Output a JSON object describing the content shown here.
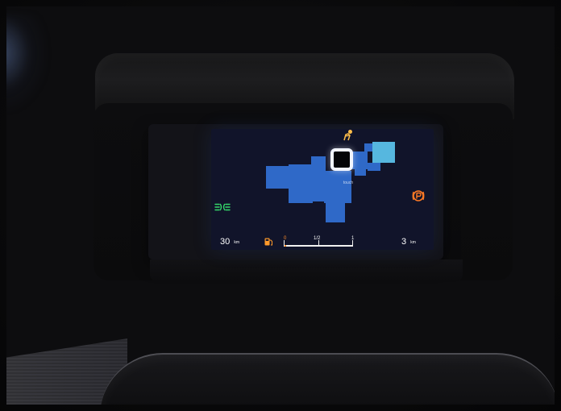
{
  "dashboard": {
    "left_range_value": "30",
    "left_range_unit": "km",
    "right_range_value": "3",
    "right_range_unit": "km",
    "center_small_label": "touch",
    "fuel_gauge": {
      "marks": [
        "0",
        "1/2",
        "1"
      ],
      "level_fraction": 0.04
    },
    "icons": {
      "top": "seat-belt-warning-icon",
      "left": "front-lights-icon",
      "right": "parking-brake-icon",
      "fuel": "fuel-pump-icon"
    },
    "colors": {
      "screen_background": "#11142a",
      "blue_area": "#2f69c8",
      "cyan_area": "#56b7df",
      "white_text": "#ffffff",
      "warning_orange": "#ff8e2a",
      "light_green": "#34d86a"
    }
  }
}
